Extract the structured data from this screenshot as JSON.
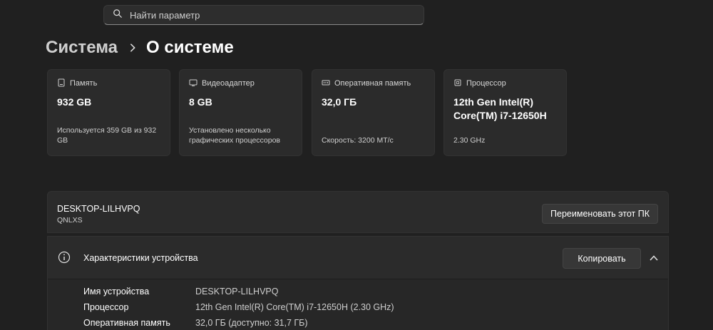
{
  "search": {
    "placeholder": "Найти параметр"
  },
  "breadcrumb": {
    "parent": "Система",
    "current": "О системе"
  },
  "cards": [
    {
      "icon": "storage-icon",
      "label": "Память",
      "value": "932 GB",
      "sub": "Используется 359 GB из 932 GB"
    },
    {
      "icon": "gpu-icon",
      "label": "Видеоадаптер",
      "value": "8 GB",
      "sub": "Установлено несколько графических процессоров"
    },
    {
      "icon": "ram-icon",
      "label": "Оперативная память",
      "value": "32,0 ГБ",
      "sub": "Скорость: 3200 МТ/с"
    },
    {
      "icon": "cpu-icon",
      "label": "Процессор",
      "value": "12th Gen Intel(R) Core(TM) i7-12650H",
      "sub": "2.30 GHz"
    }
  ],
  "pc": {
    "name": "DESKTOP-LILHVPQ",
    "workgroup": "QNLXS",
    "rename_label": "Переименовать этот ПК"
  },
  "specs": {
    "title": "Характеристики устройства",
    "copy_label": "Копировать",
    "rows": [
      {
        "label": "Имя устройства",
        "value": "DESKTOP-LILHVPQ"
      },
      {
        "label": "Процессор",
        "value": "12th Gen Intel(R) Core(TM) i7-12650H (2.30 GHz)"
      },
      {
        "label": "Оперативная память",
        "value": "32,0 ГБ (доступно: 31,7 ГБ)"
      }
    ]
  }
}
